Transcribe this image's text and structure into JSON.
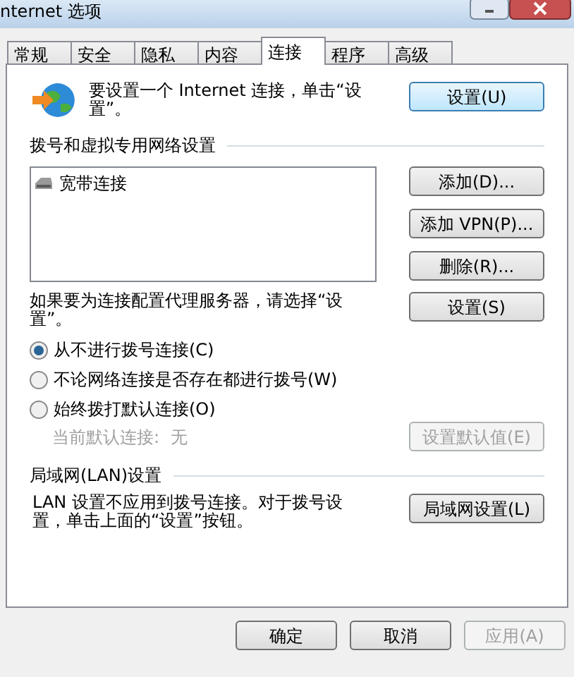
{
  "window": {
    "title": "nternet 选项"
  },
  "tabs": [
    {
      "label": "常规",
      "selected": false
    },
    {
      "label": "安全",
      "selected": false
    },
    {
      "label": "隐私",
      "selected": false
    },
    {
      "label": "内容",
      "selected": false
    },
    {
      "label": "连接",
      "selected": true
    },
    {
      "label": "程序",
      "selected": false
    },
    {
      "label": "高级",
      "selected": false
    }
  ],
  "setup": {
    "text": "要设置一个 Internet 连接，单击“设置”。",
    "button": "设置(U)"
  },
  "dialup": {
    "heading": "拨号和虚拟专用网络设置",
    "connections": [
      {
        "label": "宽带连接"
      }
    ],
    "buttons": [
      "添加(D)...",
      "添加 VPN(P)...",
      "删除(R)..."
    ]
  },
  "proxy": {
    "text": "如果要为连接配置代理服务器，请选择“设置”。",
    "button": "设置(S)"
  },
  "options": [
    {
      "label": "从不进行拨号连接(C)",
      "selected": true
    },
    {
      "label": "不论网络连接是否存在都进行拨号(W)",
      "selected": false
    },
    {
      "label": "始终拨打默认连接(O)",
      "selected": false
    }
  ],
  "default_connection": {
    "label": "当前默认连接:",
    "value": "无",
    "button": "设置默认值(E)",
    "disabled": true
  },
  "lan": {
    "heading": "局域网(LAN)设置",
    "text": "LAN 设置不应用到拨号连接。对于拨号设置，单击上面的“设置”按钮。",
    "button": "局域网设置(L)"
  },
  "footer_buttons": [
    {
      "label": "确定",
      "disabled": false
    },
    {
      "label": "取消",
      "disabled": false
    },
    {
      "label": "应用(A)",
      "disabled": true
    }
  ]
}
